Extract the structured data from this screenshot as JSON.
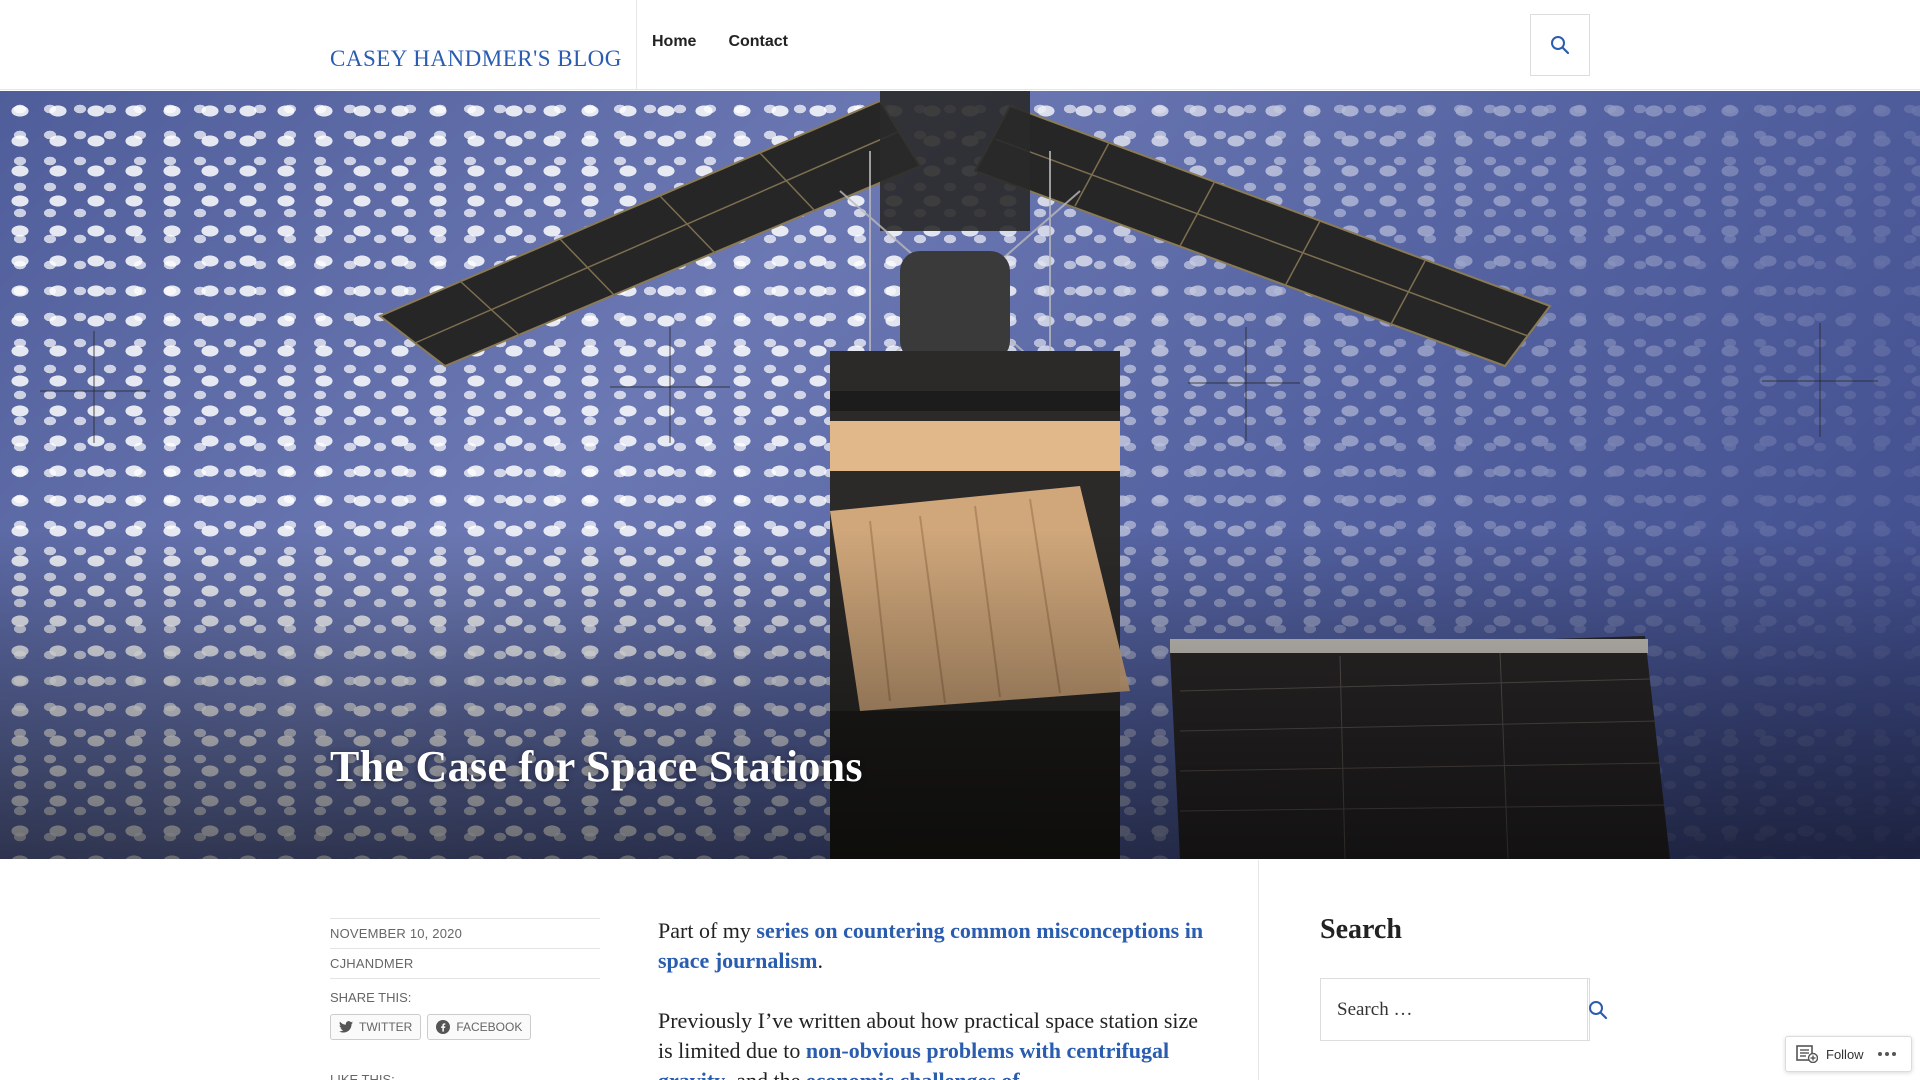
{
  "header": {
    "site_title": "CASEY HANDMER'S BLOG",
    "nav": [
      {
        "label": "Home"
      },
      {
        "label": "Contact"
      }
    ],
    "search_icon": "search-icon"
  },
  "hero": {
    "title": "The Case for Space Stations"
  },
  "meta": {
    "date": "NOVEMBER 10, 2020",
    "author": "CJHANDMER",
    "share_title": "SHARE THIS:",
    "share_buttons": [
      {
        "label": "TWITTER",
        "icon": "twitter-icon"
      },
      {
        "label": "FACEBOOK",
        "icon": "facebook-icon"
      }
    ],
    "like_title": "LIKE THIS:"
  },
  "content": {
    "p1_prefix": "Part of my ",
    "p1_link": "series on countering common misconceptions in space journalism",
    "p1_suffix": ".",
    "p2_text": "Previously I’ve written about how practical space station size is limited due to ",
    "p2_link": "non-obvious problems with centrifugal gravity",
    "p2_mid": ", and the ",
    "p2_link2": "economic challenges of"
  },
  "sidebar": {
    "widget_title": "Search",
    "search_placeholder": "Search …"
  },
  "follow": {
    "label": "Follow",
    "icon": "reader-follow-icon"
  },
  "colors": {
    "link": "#2a5db0",
    "hero_sky": "#5563a2"
  }
}
